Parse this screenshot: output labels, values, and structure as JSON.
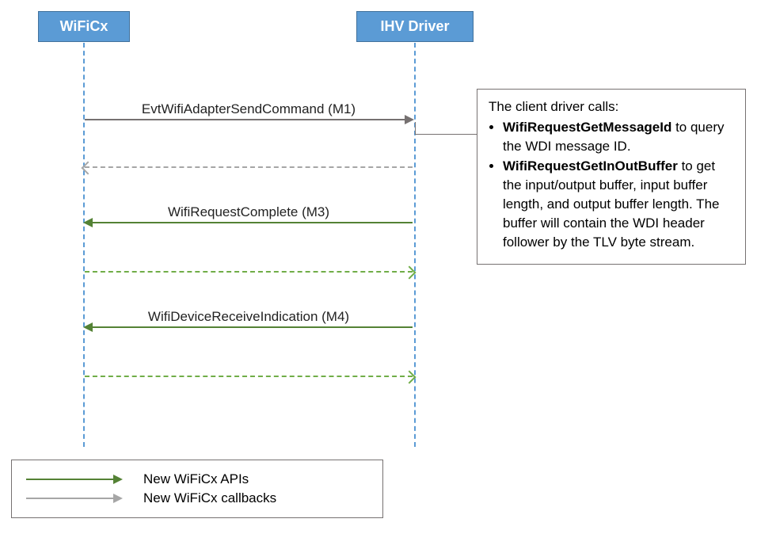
{
  "actors": {
    "wificx": "WiFiCx",
    "ihv": "IHV Driver"
  },
  "messages": {
    "m1": "EvtWifiAdapterSendCommand (M1)",
    "m3": "WifiRequestComplete (M3)",
    "m4": "WifiDeviceReceiveIndication (M4)"
  },
  "note": {
    "title": "The client driver calls:",
    "item1_bold": "WifiRequestGetMessageId",
    "item1_rest": " to query the WDI message ID.",
    "item2_bold": "WifiRequestGetInOutBuffer",
    "item2_rest": " to get the input/output buffer, input buffer length, and output buffer length. The buffer will contain the WDI header follower by the TLV byte stream."
  },
  "legend": {
    "apis": "New WiFiCx APIs",
    "callbacks": "New WiFiCx callbacks"
  }
}
